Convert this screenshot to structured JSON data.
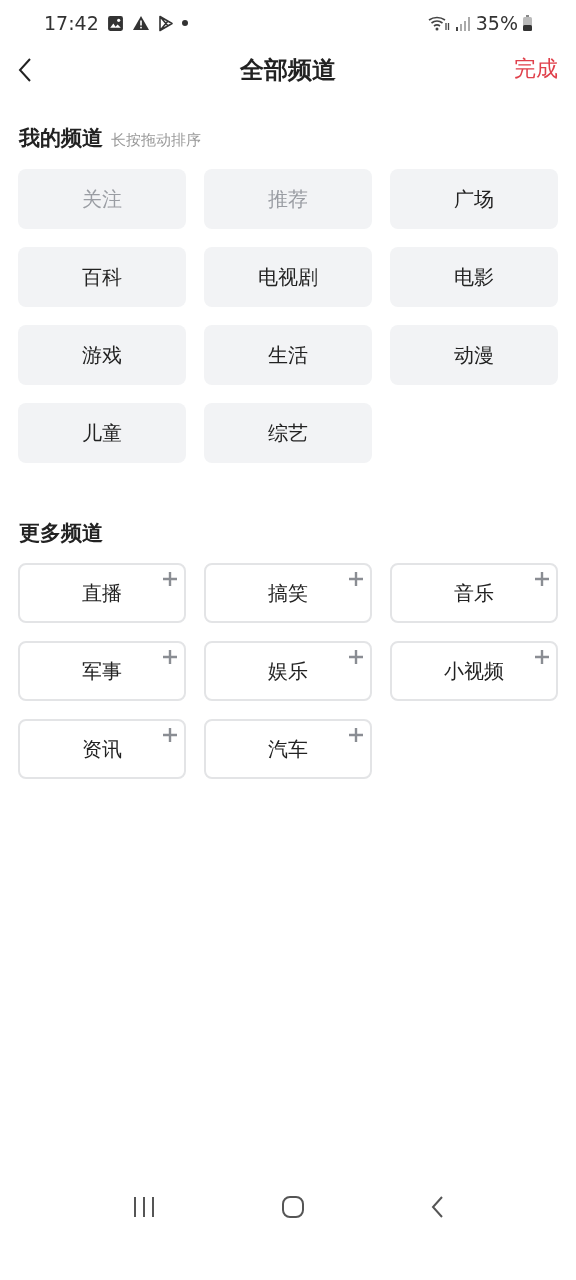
{
  "status_bar": {
    "time": "17:42",
    "battery": "35%"
  },
  "header": {
    "title": "全部频道",
    "done": "完成"
  },
  "my_channels": {
    "title": "我的频道",
    "hint": "长按拖动排序",
    "items": [
      {
        "label": "关注",
        "disabled": true
      },
      {
        "label": "推荐",
        "disabled": true
      },
      {
        "label": "广场",
        "disabled": false
      },
      {
        "label": "百科",
        "disabled": false
      },
      {
        "label": "电视剧",
        "disabled": false
      },
      {
        "label": "电影",
        "disabled": false
      },
      {
        "label": "游戏",
        "disabled": false
      },
      {
        "label": "生活",
        "disabled": false
      },
      {
        "label": "动漫",
        "disabled": false
      },
      {
        "label": "儿童",
        "disabled": false
      },
      {
        "label": "综艺",
        "disabled": false
      }
    ]
  },
  "more_channels": {
    "title": "更多频道",
    "items": [
      "直播",
      "搞笑",
      "音乐",
      "军事",
      "娱乐",
      "小视频",
      "资讯",
      "汽车"
    ]
  }
}
